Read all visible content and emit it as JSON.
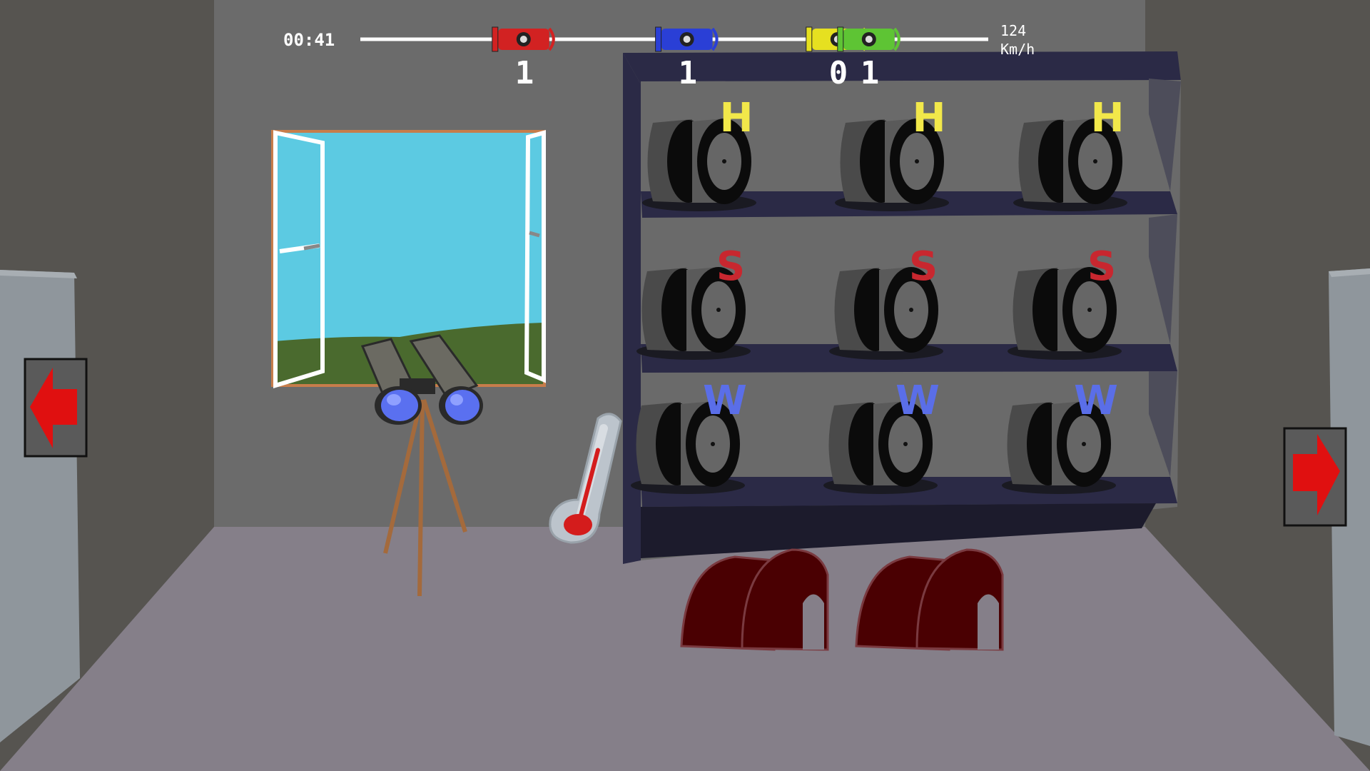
{
  "hud": {
    "race_timer": "00:41",
    "speed_value": "124",
    "speed_unit": "Km/h",
    "track_progress": [
      {
        "car": "red",
        "color": "#d22222",
        "progress": 0.26,
        "lap": "1"
      },
      {
        "car": "blue",
        "color": "#2a3fd6",
        "progress": 0.52,
        "lap": "1"
      },
      {
        "car": "yellow",
        "color": "#e6e020",
        "progress": 0.76,
        "lap": "0"
      },
      {
        "car": "green",
        "color": "#5ec434",
        "progress": 0.81,
        "lap": "1"
      }
    ]
  },
  "tyre_rack": {
    "rows": [
      {
        "compound": "hard",
        "letter": "H",
        "color": "#f2e84a",
        "sets": 3
      },
      {
        "compound": "soft",
        "letter": "S",
        "color": "#c8272f",
        "sets": 3
      },
      {
        "compound": "wet",
        "letter": "W",
        "color": "#5a6ee8",
        "sets": 3
      }
    ]
  },
  "navigation": {
    "left_arrow_icon": "arrow-left-icon",
    "right_arrow_icon": "arrow-right-icon",
    "arrow_color": "#e01010"
  },
  "objects": {
    "binoculars": "binoculars-icon",
    "thermometer": "thermometer-icon",
    "thermometer_level": 0.75,
    "window": "window-icon",
    "wheel_covers": "tyre-blanket-icon"
  }
}
